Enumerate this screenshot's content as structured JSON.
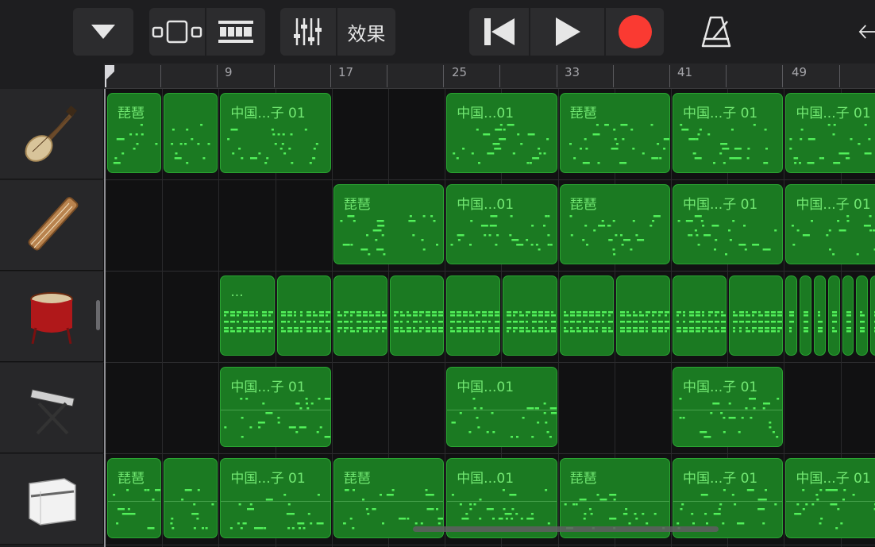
{
  "toolbar": {
    "effects_label": "效果",
    "icons": [
      "dropdown-triangle-icon",
      "tracks-view-icon",
      "grid-view-icon",
      "mixer-icon",
      "rewind-icon",
      "play-icon",
      "record-icon",
      "metronome-icon",
      "back-arrow-icon"
    ],
    "record_color": "#fa3a32"
  },
  "ruler": {
    "bar_labels": [
      "9",
      "17",
      "25",
      "33",
      "41",
      "49"
    ]
  },
  "tracks": [
    {
      "instrument": "pipa-icon"
    },
    {
      "instrument": "guzheng-icon"
    },
    {
      "instrument": "drum-icon"
    },
    {
      "instrument": "keyboard-icon"
    },
    {
      "instrument": "organ-icon"
    }
  ],
  "regions": [
    [
      {
        "name": "琵琶",
        "start": 1,
        "bars": 4
      },
      {
        "name": "",
        "start": 5,
        "bars": 4
      },
      {
        "name": "中国...子 01",
        "start": 9,
        "bars": 8
      },
      {
        "name": "中国...01",
        "start": 25,
        "bars": 8
      },
      {
        "name": "琵琶",
        "start": 33,
        "bars": 8
      },
      {
        "name": "中国...子 01",
        "start": 41,
        "bars": 8
      },
      {
        "name": "中国...子 01",
        "start": 49,
        "bars": 8
      }
    ],
    [
      {
        "name": "琵琶",
        "start": 17,
        "bars": 8
      },
      {
        "name": "中国...01",
        "start": 25,
        "bars": 8
      },
      {
        "name": "琵琶",
        "start": 33,
        "bars": 8
      },
      {
        "name": "中国...子 01",
        "start": 41,
        "bars": 8
      },
      {
        "name": "中国...子 01",
        "start": 49,
        "bars": 8
      }
    ],
    [
      {
        "name": "...",
        "start": 9,
        "bars": 4
      },
      {
        "name": "",
        "start": 13,
        "bars": 4
      },
      {
        "name": "",
        "start": 17,
        "bars": 4
      },
      {
        "name": "",
        "start": 21,
        "bars": 4
      },
      {
        "name": "",
        "start": 25,
        "bars": 4
      },
      {
        "name": "",
        "start": 29,
        "bars": 4
      },
      {
        "name": "",
        "start": 33,
        "bars": 4
      },
      {
        "name": "",
        "start": 37,
        "bars": 4
      },
      {
        "name": "",
        "start": 41,
        "bars": 4
      },
      {
        "name": "",
        "start": 45,
        "bars": 4
      },
      {
        "name": "",
        "start": 49,
        "bars": 1
      },
      {
        "name": "",
        "start": 50,
        "bars": 1
      },
      {
        "name": "",
        "start": 51,
        "bars": 1
      },
      {
        "name": "",
        "start": 52,
        "bars": 1
      },
      {
        "name": "",
        "start": 53,
        "bars": 1
      },
      {
        "name": "",
        "start": 54,
        "bars": 1
      },
      {
        "name": "",
        "start": 55,
        "bars": 1
      },
      {
        "name": "",
        "start": 56,
        "bars": 1
      }
    ],
    [
      {
        "name": "中国...子 01",
        "start": 9,
        "bars": 8
      },
      {
        "name": "中国...01",
        "start": 25,
        "bars": 8
      },
      {
        "name": "中国...子 01",
        "start": 41,
        "bars": 8
      }
    ],
    [
      {
        "name": "琵琶",
        "start": 1,
        "bars": 4
      },
      {
        "name": "",
        "start": 5,
        "bars": 4
      },
      {
        "name": "中国...子 01",
        "start": 9,
        "bars": 8
      },
      {
        "name": "琵琶",
        "start": 17,
        "bars": 8
      },
      {
        "name": "中国...01",
        "start": 25,
        "bars": 8
      },
      {
        "name": "琵琶",
        "start": 33,
        "bars": 8
      },
      {
        "name": "中国...子 01",
        "start": 41,
        "bars": 8
      },
      {
        "name": "中国...子 01",
        "start": 49,
        "bars": 8
      }
    ]
  ]
}
